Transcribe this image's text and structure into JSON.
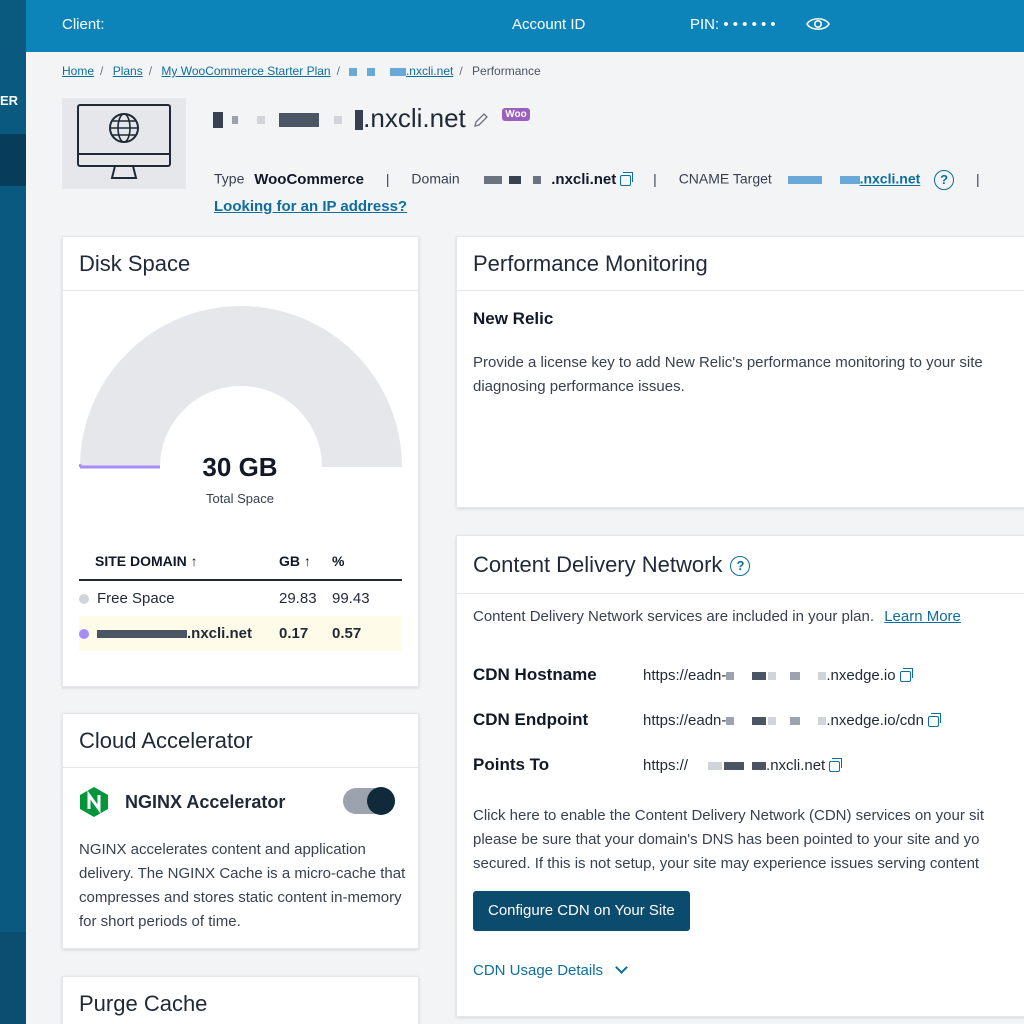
{
  "sidebar": {
    "label": "ER"
  },
  "topbar": {
    "client_label": "Client:",
    "account_label": "Account ID",
    "pin_label": "PIN: • • • • • •"
  },
  "breadcrumb": {
    "home": "Home",
    "plans": "Plans",
    "plan_name": "My WooCommerce Starter Plan",
    "site": ".nxcli.net",
    "current": "Performance"
  },
  "site": {
    "name_suffix": ".nxcli.net",
    "woo_badge": "Woo",
    "type_label": "Type",
    "type_value": "WooCommerce",
    "domain_label": "Domain",
    "domain_suffix": ".nxcli.net",
    "cname_label": "CNAME Target",
    "cname_suffix": ".nxcli.net",
    "ip_link": "Looking for an IP address?"
  },
  "disk": {
    "title": "Disk Space",
    "total": "30 GB",
    "total_label": "Total Space",
    "used_fraction": 0.0057,
    "columns": [
      "SITE DOMAIN ↑",
      "GB ↑",
      "%"
    ],
    "rows": [
      {
        "name": "Free Space",
        "gb": "29.83",
        "pct": "99.43",
        "color": "#d1d5db"
      },
      {
        "name": ".nxcli.net",
        "gb": "0.17",
        "pct": "0.57",
        "color": "#a78bfa"
      }
    ]
  },
  "cloud": {
    "title": "Cloud Accelerator",
    "nginx_label": "NGINX Accelerator",
    "toggle_on": true,
    "description": "NGINX accelerates content and application delivery. The NGINX Cache is a micro-cache that compresses and stores static content in-memory for short periods of time."
  },
  "purge": {
    "title": "Purge Cache"
  },
  "performance": {
    "title": "Performance Monitoring",
    "subtitle": "New Relic",
    "line1": "Provide a license key to add New Relic's performance monitoring to your site",
    "line2": "diagnosing performance issues."
  },
  "cdn": {
    "title": "Content Delivery Network",
    "intro": "Content Delivery Network services are included in your plan.",
    "learn_more": "Learn More",
    "hostname_label": "CDN Hostname",
    "hostname_prefix": "https://eadn-",
    "hostname_suffix": ".nxedge.io",
    "endpoint_label": "CDN Endpoint",
    "endpoint_prefix": "https://eadn-",
    "endpoint_suffix": ".nxedge.io/cdn",
    "points_label": "Points To",
    "points_prefix": "https://",
    "points_suffix": ".nxcli.net",
    "note1": "Click here to enable the Content Delivery Network (CDN) services on your sit",
    "note2": "please be sure that your domain's DNS has been pointed to your site and yo",
    "note3": "secured. If this is not setup, your site may experience issues serving content",
    "button": "Configure CDN on Your Site",
    "usage": "CDN Usage Details"
  },
  "colors": {
    "brand": "#0d84b9",
    "primary_button": "#0a4b6e",
    "link": "#0d6e9e",
    "gauge_used": "#a78bfa"
  }
}
